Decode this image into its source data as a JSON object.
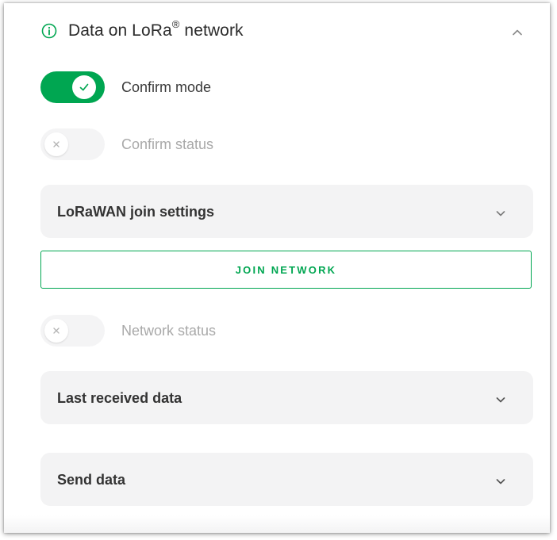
{
  "panel": {
    "title": "Data on LoRa",
    "title_superscript": "®",
    "title_suffix": " network",
    "title_icon": "info-icon",
    "collapse_icon": "chevron-up-icon"
  },
  "toggles": {
    "confirm_mode": {
      "label": "Confirm mode",
      "state": "on",
      "icon": "check-icon"
    },
    "confirm_status": {
      "label": "Confirm status",
      "state": "off",
      "icon": "x-icon"
    },
    "network_status": {
      "label": "Network status",
      "state": "off",
      "icon": "x-icon"
    }
  },
  "sections": {
    "join_settings": {
      "label": "LoRaWAN join settings",
      "icon": "chevron-down-icon"
    },
    "last_received": {
      "label": "Last received data",
      "icon": "chevron-down-icon"
    },
    "send_data": {
      "label": "Send data",
      "icon": "chevron-down-icon"
    }
  },
  "actions": {
    "join_network_label": "JOIN NETWORK"
  },
  "colors": {
    "accent": "#00a651",
    "toggle_off_bg": "#f4f4f5",
    "section_bg": "#f3f3f4",
    "text_primary": "#333333",
    "text_muted": "#a9a9a9"
  }
}
